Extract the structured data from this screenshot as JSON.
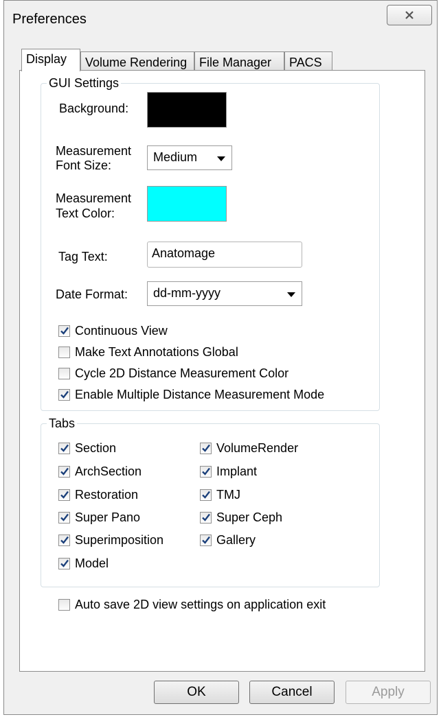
{
  "window": {
    "title": "Preferences",
    "close_icon": "close-icon"
  },
  "tabs": [
    {
      "label": "Display",
      "active": true
    },
    {
      "label": "Volume Rendering",
      "active": false
    },
    {
      "label": "File Manager",
      "active": false
    },
    {
      "label": "PACS",
      "active": false
    }
  ],
  "gui": {
    "legend": "GUI Settings",
    "background_label": "Background:",
    "background_color": "#000000",
    "font_size_label_1": "Measurement",
    "font_size_label_2": "Font Size:",
    "font_size_value": "Medium",
    "text_color_label_1": "Measurement",
    "text_color_label_2": "Text Color:",
    "text_color_value": "#00ffff",
    "tag_text_label": "Tag Text:",
    "tag_text_value": "Anatomage",
    "date_format_label": "Date Format:",
    "date_format_value": "dd-mm-yyyy",
    "options": [
      {
        "label": "Continuous View",
        "checked": true
      },
      {
        "label": "Make Text Annotations Global",
        "checked": false
      },
      {
        "label": "Cycle 2D Distance Measurement Color",
        "checked": false
      },
      {
        "label": "Enable Multiple Distance Measurement Mode",
        "checked": true
      }
    ]
  },
  "tabs_group": {
    "legend": "Tabs",
    "left": [
      {
        "label": "Section",
        "checked": true
      },
      {
        "label": "ArchSection",
        "checked": true
      },
      {
        "label": "Restoration",
        "checked": true
      },
      {
        "label": "Super Pano",
        "checked": true
      },
      {
        "label": "Superimposition",
        "checked": true
      },
      {
        "label": "Model",
        "checked": true
      }
    ],
    "right": [
      {
        "label": "VolumeRender",
        "checked": true
      },
      {
        "label": "Implant",
        "checked": true
      },
      {
        "label": "TMJ",
        "checked": true
      },
      {
        "label": "Super Ceph",
        "checked": true
      },
      {
        "label": "Gallery",
        "checked": true
      }
    ]
  },
  "autosave": {
    "label": "Auto save 2D view settings on application exit",
    "checked": false
  },
  "buttons": {
    "ok": "OK",
    "cancel": "Cancel",
    "apply": "Apply"
  },
  "colors": {
    "checkmark": "#1a3f7a"
  }
}
